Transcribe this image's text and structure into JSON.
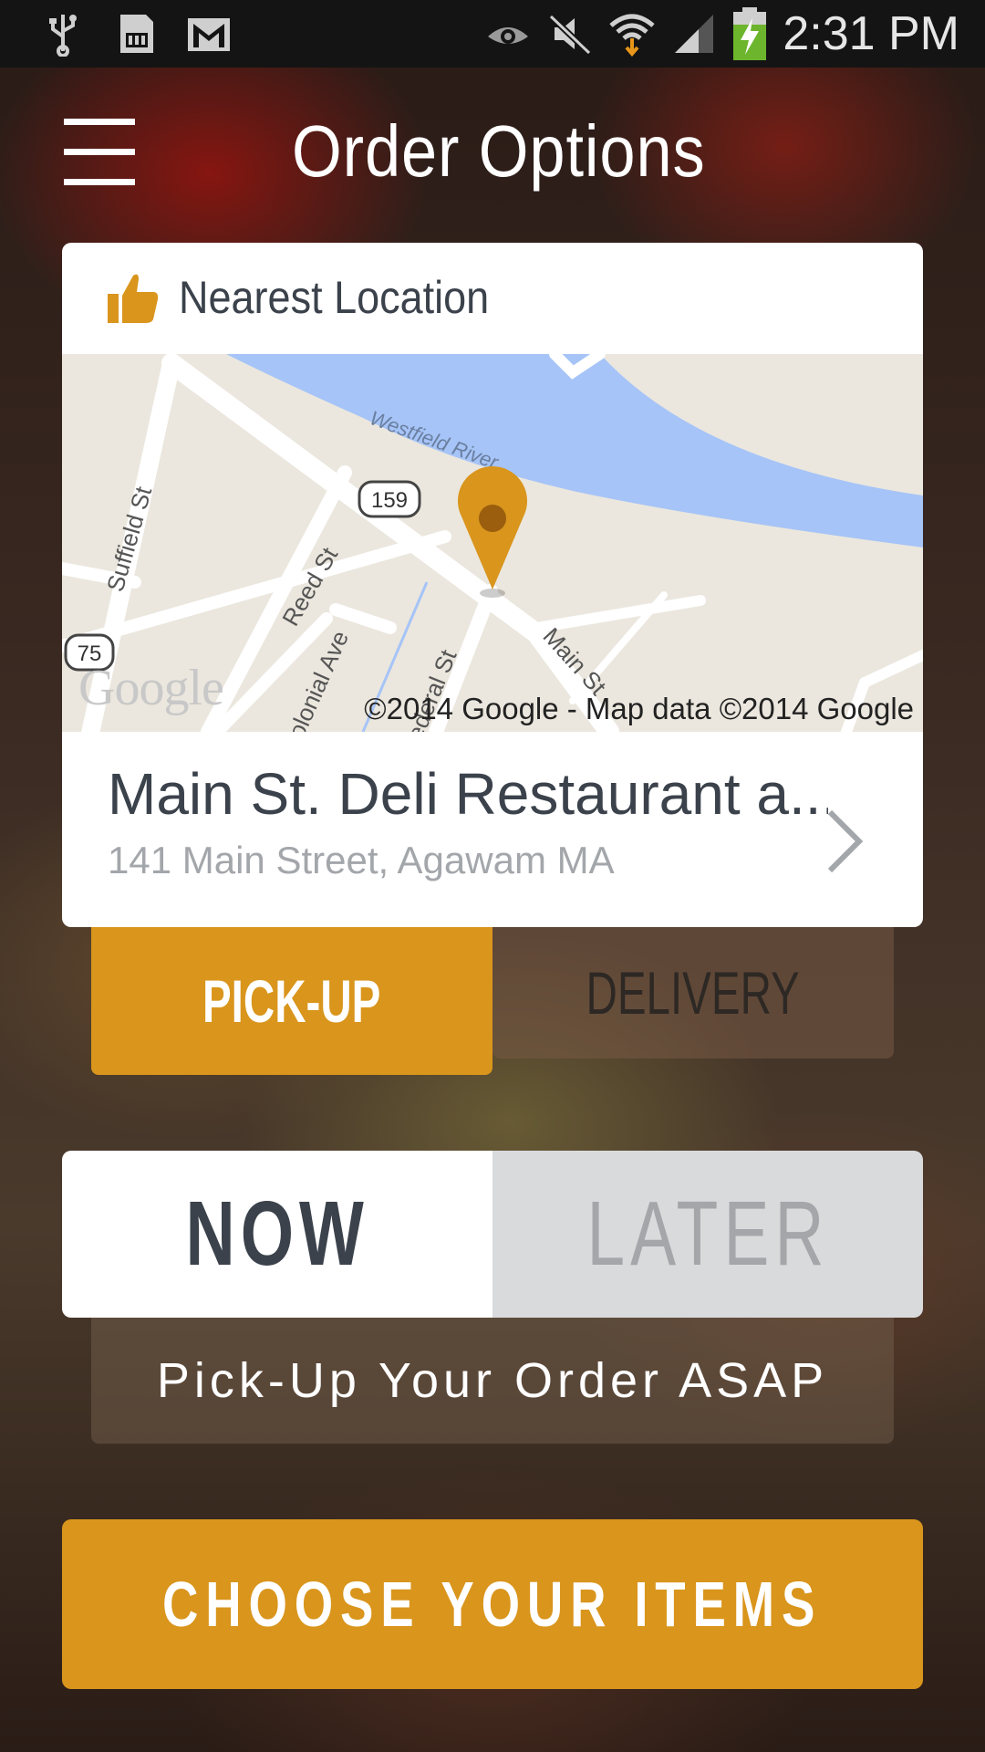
{
  "status_bar": {
    "time": "2:31 PM",
    "left_icons": [
      "usb-icon",
      "sd-card-icon",
      "gmail-icon"
    ],
    "right_icons": [
      "eye-icon",
      "mute-icon",
      "wifi-icon",
      "signal-icon",
      "battery-charging-icon"
    ]
  },
  "header": {
    "title": "Order Options",
    "menu_icon": "hamburger-menu-icon"
  },
  "location_card": {
    "heading": "Nearest Location",
    "heading_icon": "thumbs-up-icon",
    "map": {
      "attribution": "©2014 Google - Map data ©2014 Google",
      "logo": "Google",
      "labels": {
        "river": "Westfield River",
        "route_159": "159",
        "route_75": "75",
        "suffield": "Suffield St",
        "reed": "Reed St",
        "main": "Main St",
        "federal": "Federal St",
        "colonial": "Colonial Ave"
      }
    },
    "name": "Main St. Deli Restaurant a...",
    "address": "141 Main Street, Agawam MA"
  },
  "order_type": {
    "pickup_label": "PICK-UP",
    "delivery_label": "DELIVERY",
    "selected": "PICK-UP"
  },
  "timing": {
    "now_label": "NOW",
    "later_label": "LATER",
    "selected": "NOW",
    "description": "Pick-Up Your Order ASAP"
  },
  "cta": {
    "label": "CHOOSE YOUR ITEMS"
  },
  "colors": {
    "accent": "#d9951c",
    "text_dark": "#3b424b",
    "text_muted": "#a3a6aa",
    "river": "#a6c4f7"
  }
}
